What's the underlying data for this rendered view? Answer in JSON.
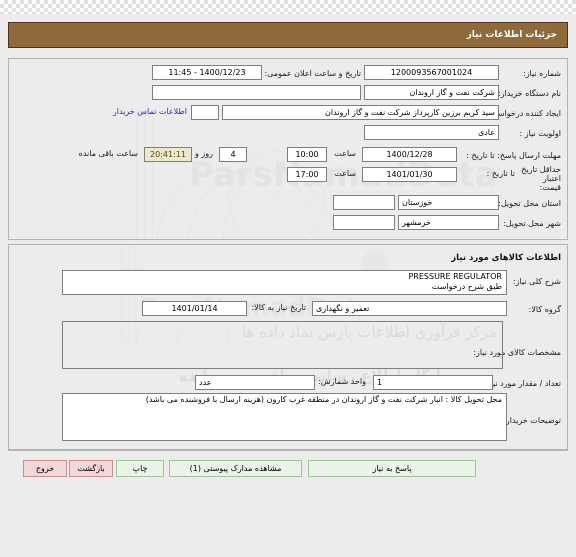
{
  "header": {
    "title": "جزئیات اطلاعات نیاز",
    "bar_color": "#906a3a"
  },
  "need_info": {
    "need_number": {
      "label": "شماره نیاز:",
      "value": "1200093567001024"
    },
    "public_announce": {
      "label": "تاریخ و ساعت اعلان عمومی:",
      "value": "1400/12/23 - 11:45"
    },
    "buyer_org": {
      "label": "نام دستگاه خریدار:",
      "value": "شرکت نفت و گاز اروندان",
      "extra_value": ""
    },
    "request_creator": {
      "label": "ایجاد کننده درخواست:",
      "value": "سید کریم برزین کارپرداز شرکت نفت و گاز اروندان"
    },
    "contact_link": "اطلاعات تماس خریدار",
    "priority": {
      "label": "اولویت نیاز :",
      "value": "عادی"
    },
    "response_deadline": {
      "label": "مهلت ارسال پاسخ: تا تاریخ :",
      "date": "1400/12/28",
      "time_label": "ساعت",
      "time": "10:00",
      "days": "4",
      "days_unit": "روز و",
      "countdown": "20:41:11",
      "countdown_suffix": "ساعت باقی مانده"
    },
    "price_validity": {
      "label": "حداقل تاریخ اعتبار قیمت:",
      "until_label": "تا تاریخ :",
      "date": "1401/01/30",
      "time_label": "ساعت",
      "time": "17:00"
    },
    "province": {
      "label": "استان محل تحویل:",
      "value": "خوزستان"
    },
    "city": {
      "label": "شهر محل تحویل:",
      "value": "خرمشهر"
    }
  },
  "goods_info": {
    "section_title": "اطلاعات کالاهای مورد نیاز",
    "general_desc": {
      "label": "شرح کلی نیاز:",
      "line1": "PRESSURE REGULATOR",
      "line2": "طبق شرح درخواست"
    },
    "goods_group": {
      "label": "گروه کالا:",
      "value": "تعمیر و نگهداری"
    },
    "ready_date": {
      "label": "تاریخ نیاز به کالا:",
      "value": "1401/01/14"
    },
    "specs": {
      "label": "مشخصات کالای مورد نیاز:",
      "value": ""
    },
    "quantity": {
      "label": "تعداد / مقدار مورد نیاز:",
      "value": "1",
      "unit_label": "واحد شمارش:",
      "unit_value": "عدد"
    },
    "buyer_notes": {
      "label": "توضیحات خریدار:",
      "value": "محل تحویل کالا : انبار شرکت نفت و گاز اروندان در منطقه غرب کارون (هزینه ارسال با فروشنده می باشد)"
    }
  },
  "actions": {
    "respond": "پاسخ به نیاز",
    "view_docs": "مشاهده مدارک پیوستی (1)",
    "print": "چاپ",
    "back": "بازگشت",
    "exit": "خروج"
  },
  "watermarks": {
    "main": "مرکز فرآوری اطلاعات پارس نماد داده ها",
    "secondary": "پایگاه اطلاع رسانی مناقصه و مزایده",
    "brand": "ParsNamadData"
  }
}
